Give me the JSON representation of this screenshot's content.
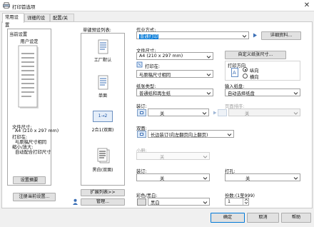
{
  "window": {
    "title": "打印首选项",
    "close_glyph": "✕",
    "icon": "printer-icon"
  },
  "tabs": [
    {
      "label": "常用设置",
      "active": true
    },
    {
      "label": "详细的设置",
      "active": false
    },
    {
      "label": "配置/关于",
      "active": false
    }
  ],
  "current_settings": {
    "heading": "当前设置",
    "user_setting": "用户设定",
    "doc_size_label": "文件尺寸:",
    "doc_size_value": "A4 (210 x 297 mm)",
    "print_on_label": "打印在:",
    "print_on_value": "与原稿尺寸相同",
    "zoom_label": "缩小/放大:",
    "zoom_value": "自动配合打印尺寸",
    "summary_button": "设置摘要",
    "register_button": "注册当前设置..."
  },
  "presets": {
    "heading": "单键预设列表:",
    "items": [
      {
        "label": "工厂默认",
        "icon": "factory-default-doc-icon"
      },
      {
        "label": "单面",
        "icon": "one-sided-doc-icon"
      },
      {
        "label": "2合1(双面)",
        "icon": "two-in-one-icon",
        "glyph": "1→2"
      },
      {
        "label": "黑白(双面)",
        "icon": "black-white-doc-icon"
      }
    ],
    "expand_button": "扩展列表>>",
    "manage_button": "管理..."
  },
  "job_type": {
    "label": "作业方式:",
    "value": "普通打印",
    "details_button": "详细资料..."
  },
  "document_size": {
    "label": "文件尺寸:",
    "value": "A4 (210 x 297 mm)",
    "custom_button": "自定义纸张尺寸..."
  },
  "print_on": {
    "label": "打印在:",
    "value": "与原稿尺寸相同"
  },
  "orientation": {
    "label": "打印方向",
    "options": [
      {
        "label": "纵向",
        "checked": true
      },
      {
        "label": "横向",
        "checked": false
      }
    ]
  },
  "paper_type": {
    "label": "纸张类型:",
    "value": "普通纸和再生纸"
  },
  "input_tray": {
    "label": "输入纸盘:",
    "value": "自动选择纸盘"
  },
  "duplex": {
    "label": "装订:",
    "value": "关"
  },
  "pages_per_sheet": {
    "label": "页面排序:",
    "value": "关"
  },
  "two_sided": {
    "label": "双面:",
    "value": "长边装订(向左翻页向上翻页)"
  },
  "staple": {
    "label": "小册:",
    "value": "关"
  },
  "binding": {
    "label": "装订:",
    "value": "关"
  },
  "punch": {
    "label": "打孔:",
    "value": "关"
  },
  "color": {
    "label": "彩色/黑白:",
    "value": "黑白"
  },
  "copies": {
    "label": "份数:(1至999)",
    "value": "1"
  },
  "footer": {
    "ok": "确定",
    "cancel": "取消",
    "help": "帮助"
  },
  "colors": {
    "accent": "#0078d7",
    "selection": "#0078d7",
    "icon_blue": "#3b6fb6"
  }
}
